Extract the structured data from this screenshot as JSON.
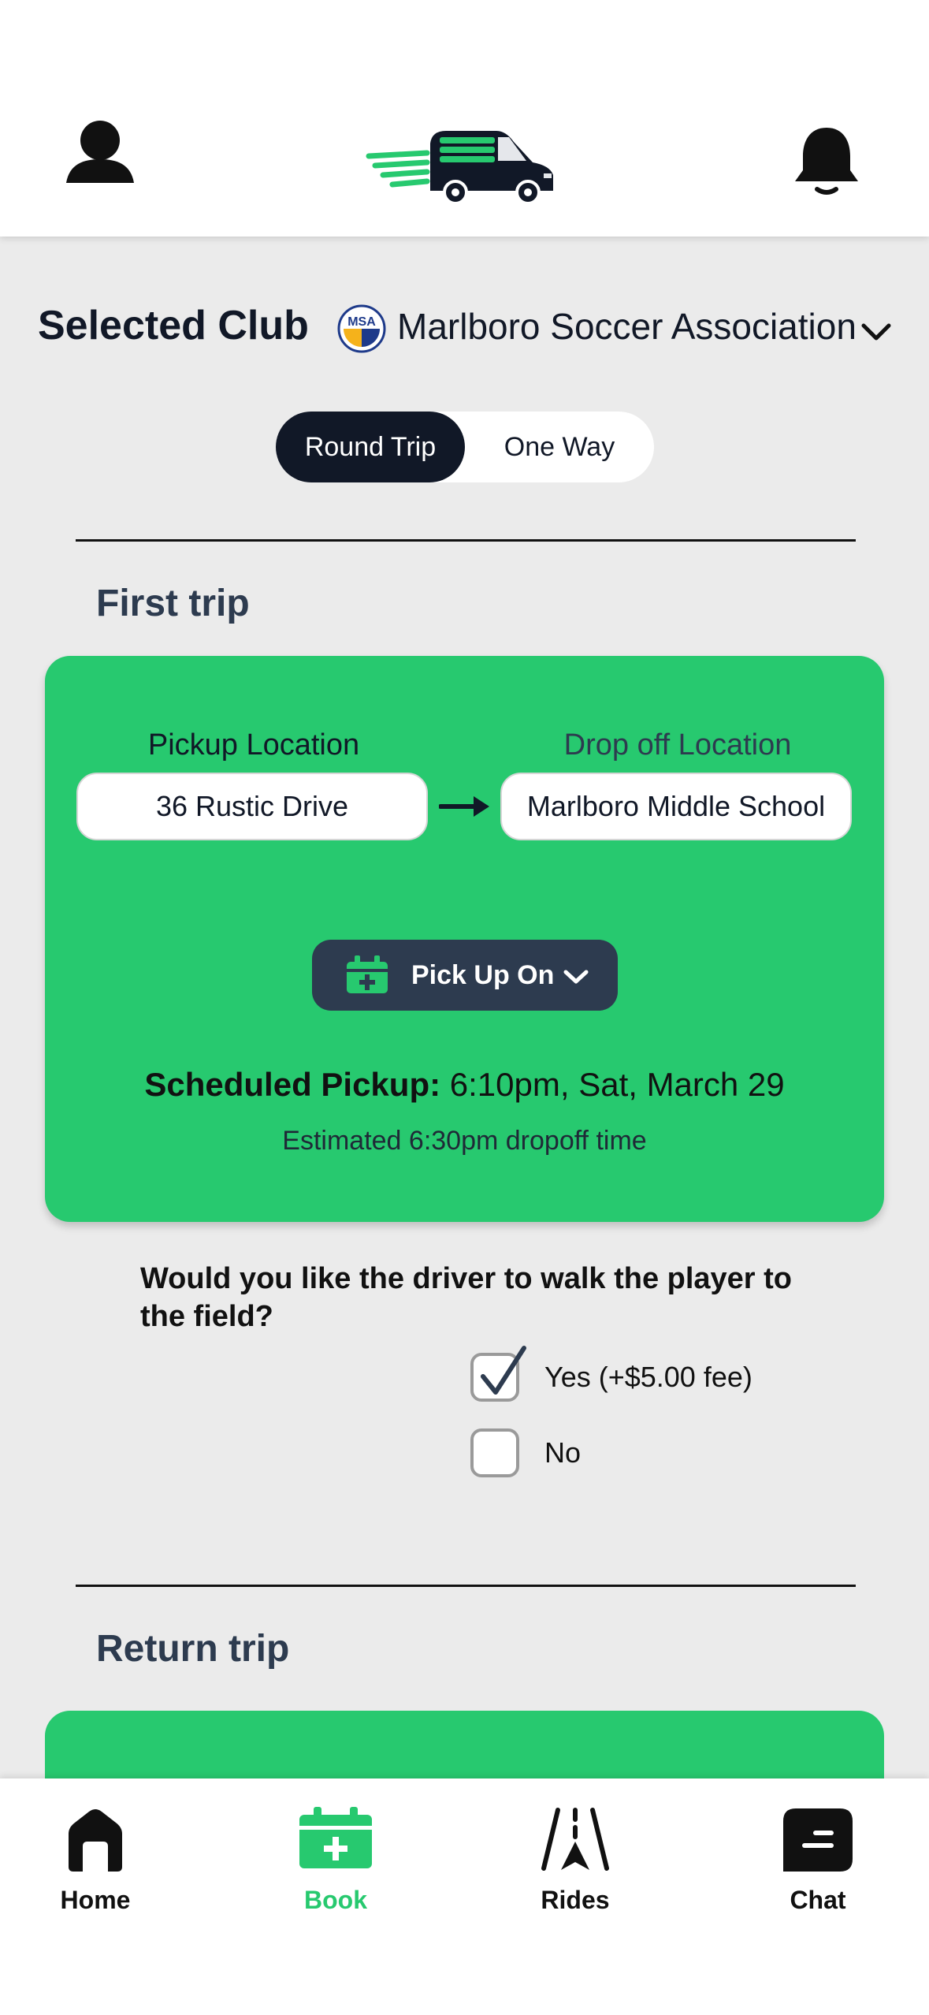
{
  "header": {
    "profile_icon": "person-icon",
    "logo_icon": "van-logo-icon",
    "notifications_icon": "bell-icon"
  },
  "club": {
    "title": "Selected Club",
    "badge_text": "MSA",
    "name": "Marlboro Soccer Association",
    "chevron_icon": "chevron-down-icon"
  },
  "trip_type": {
    "options": [
      "Round Trip",
      "One Way"
    ],
    "selected": "Round Trip"
  },
  "first_trip": {
    "title": "First trip",
    "pickup_label": "Pickup Location",
    "pickup_value": "36 Rustic Drive",
    "dropoff_label": "Drop off Location",
    "dropoff_value": "Marlboro Middle School",
    "pickup_button_label": "Pick Up On",
    "scheduled_label": "Scheduled Pickup:",
    "scheduled_value": "6:10pm, Sat, March 29",
    "estimate": "Estimated 6:30pm dropoff time"
  },
  "walk_question": {
    "text": "Would you like the driver to walk the player to the field?",
    "options": [
      {
        "label": "Yes (+$5.00 fee)",
        "checked": true
      },
      {
        "label": "No",
        "checked": false
      }
    ]
  },
  "return_trip": {
    "title": "Return trip"
  },
  "nav": {
    "items": [
      {
        "label": "Home",
        "icon": "home-icon",
        "active": false
      },
      {
        "label": "Book",
        "icon": "calendar-plus-icon",
        "active": true
      },
      {
        "label": "Rides",
        "icon": "road-icon",
        "active": false
      },
      {
        "label": "Chat",
        "icon": "chat-icon",
        "active": false
      }
    ]
  },
  "colors": {
    "accent": "#27c96f",
    "dark": "#111827",
    "slate": "#2d3b4f",
    "background": "#ebebeb"
  }
}
